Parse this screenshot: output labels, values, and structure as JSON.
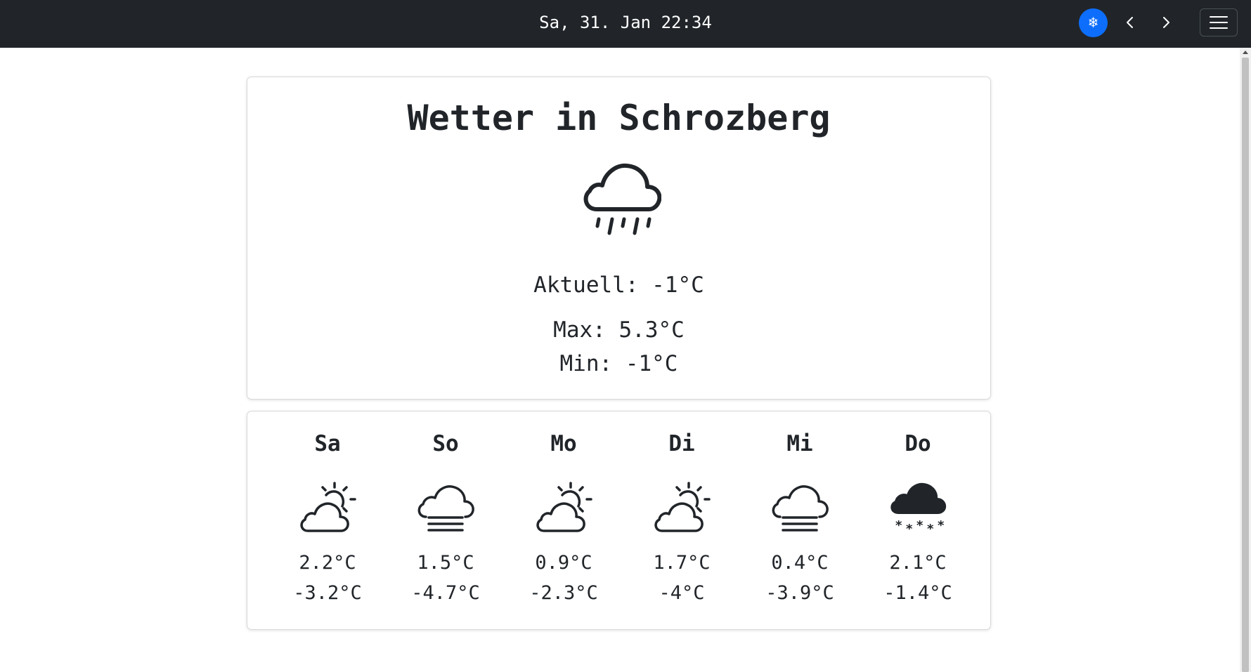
{
  "header": {
    "datetime": "Sa, 31. Jan 22:34",
    "snow_button_glyph": "❄",
    "accent_color": "#0d6efd",
    "bar_color": "#212529"
  },
  "weather": {
    "title": "Wetter in Schrozberg",
    "icon": "cloud-rain-icon",
    "current_label": "Aktuell: -1°C",
    "max_label": "Max: 5.3°C",
    "min_label": "Min: -1°C"
  },
  "forecast": [
    {
      "day": "Sa",
      "icon": "cloud-sun-icon",
      "max": "2.2°C",
      "min": "-3.2°C"
    },
    {
      "day": "So",
      "icon": "cloud-fog-icon",
      "max": "1.5°C",
      "min": "-4.7°C"
    },
    {
      "day": "Mo",
      "icon": "cloud-sun-icon",
      "max": "0.9°C",
      "min": "-2.3°C"
    },
    {
      "day": "Di",
      "icon": "cloud-sun-icon",
      "max": "1.7°C",
      "min": "-4°C"
    },
    {
      "day": "Mi",
      "icon": "cloud-fog-icon",
      "max": "0.4°C",
      "min": "-3.9°C"
    },
    {
      "day": "Do",
      "icon": "cloud-snow-icon",
      "max": "2.1°C",
      "min": "-1.4°C"
    }
  ]
}
